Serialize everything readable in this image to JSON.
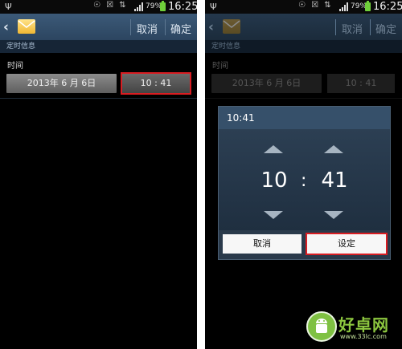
{
  "status_bar": {
    "time": "16:25",
    "battery_percent": "79%",
    "icons": [
      "usb-icon",
      "alarm-icon",
      "nfc-icon",
      "data-icon",
      "signal-icon",
      "battery-icon"
    ]
  },
  "screen_left": {
    "action_bar": {
      "cancel_label": "取消",
      "confirm_label": "确定"
    },
    "section_header": "定时信息",
    "time_label": "时间",
    "date_value": "2013年 6 月 6日",
    "time_value": "10 : 41"
  },
  "screen_right": {
    "action_bar": {
      "cancel_label": "取消",
      "confirm_label": "确定"
    },
    "section_header": "定时信息",
    "time_label": "时间",
    "date_value": "2013年 6 月 6日",
    "time_value": "10 : 41",
    "dialog": {
      "title": "10:41",
      "hour": "10",
      "separator": ":",
      "minute": "41",
      "cancel_label": "取消",
      "set_label": "设定"
    }
  },
  "watermark": {
    "name": "好卓网",
    "url": "www.33lc.com"
  },
  "colors": {
    "highlight": "#d91d22",
    "action_bar": "#3c5a78",
    "dialog": "#2b3e51",
    "watermark_green": "#8cc63f"
  }
}
